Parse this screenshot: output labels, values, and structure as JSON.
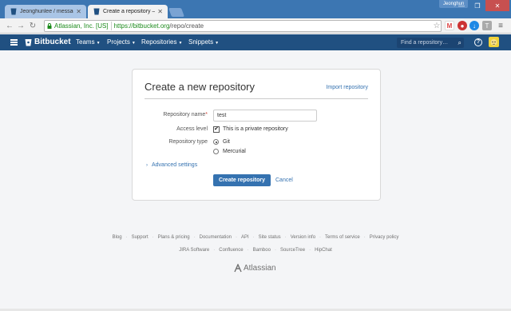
{
  "browser": {
    "tabs": [
      {
        "title": "Jeonghunlee / messagin",
        "active": false
      },
      {
        "title": "Create a repository — B",
        "active": true
      }
    ],
    "user_badge": "Jeonghun",
    "close_glyph": "✕",
    "address": {
      "security_label": "Atlassian, Inc. [US]",
      "url_scheme_host": "https://bitbucket.org",
      "url_path": "/repo/create"
    }
  },
  "header": {
    "brand": "Bitbucket",
    "nav": [
      "Teams",
      "Projects",
      "Repositories",
      "Snippets"
    ],
    "search_placeholder": "Find a repository…",
    "help_glyph": "?",
    "colors": {
      "header_bg": "#205081",
      "accent": "#3572b0"
    }
  },
  "form": {
    "title": "Create a new repository",
    "import_link": "Import repository",
    "repo_name_label": "Repository name",
    "required_mark": "*",
    "repo_name_value": "test",
    "access_label": "Access level",
    "private_option": "This is a private repository",
    "private_checked": true,
    "type_label": "Repository type",
    "type_options": [
      "Git",
      "Mercurial"
    ],
    "type_selected": "Git",
    "advanced": "Advanced settings",
    "create_button": "Create repository",
    "cancel": "Cancel"
  },
  "footer": {
    "links1": [
      "Blog",
      "Support",
      "Plans & pricing",
      "Documentation",
      "API",
      "Site status",
      "Version info",
      "Terms of service",
      "Privacy policy"
    ],
    "links2": [
      "JIRA Software",
      "Confluence",
      "Bamboo",
      "SourceTree",
      "HipChat"
    ],
    "separator": "·",
    "brand": "Atlassian"
  }
}
